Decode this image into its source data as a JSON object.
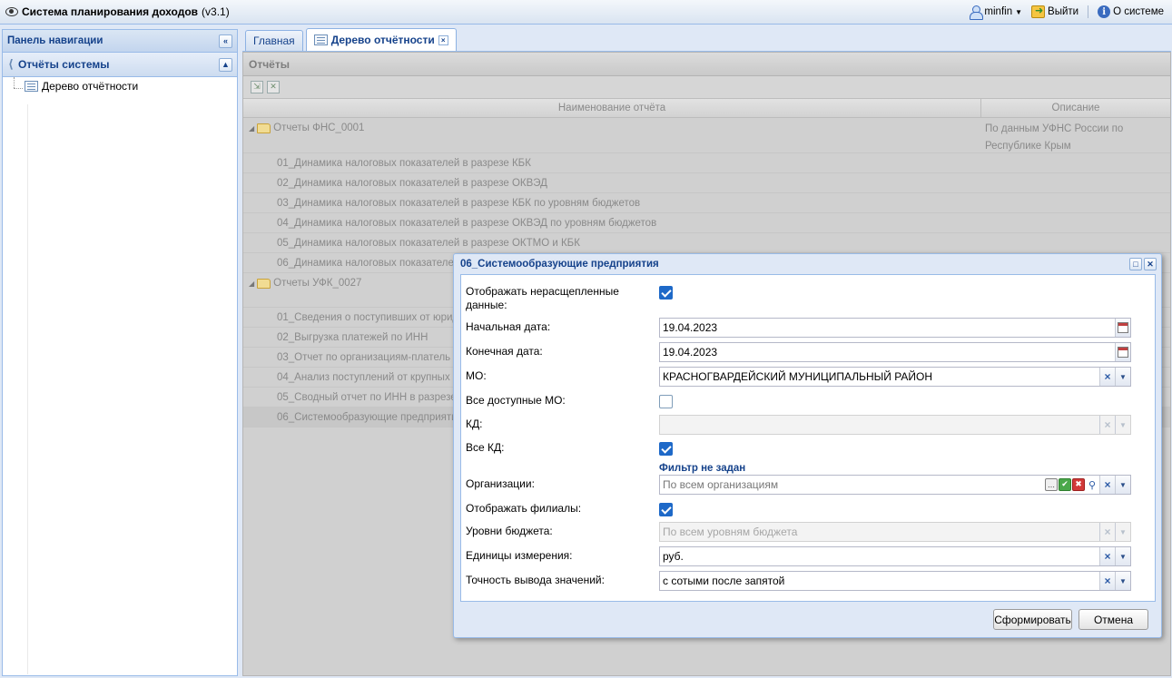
{
  "app": {
    "title": "Система планирования доходов",
    "version": "(v3.1)",
    "user_label": "minfin",
    "logout_label": "Выйти",
    "about_label": "О системе"
  },
  "nav": {
    "header": "Панель навигации",
    "section_title": "Отчёты системы",
    "items": [
      {
        "label": "Дерево отчётности"
      }
    ]
  },
  "tabs": [
    {
      "label": "Главная"
    },
    {
      "label": "Дерево отчётности"
    }
  ],
  "reports_panel": {
    "title": "Отчёты",
    "columns": {
      "name": "Наименование отчёта",
      "description": "Описание"
    },
    "groups": [
      {
        "name": "Отчеты ФНС_0001",
        "description": "По данным УФНС России по Республике Крым",
        "items": [
          "01_Динамика налоговых показателей в разрезе КБК",
          "02_Динамика налоговых показателей в разрезе ОКВЭД",
          "03_Динамика налоговых показателей в разрезе КБК по уровням бюджетов",
          "04_Динамика налоговых показателей в разрезе ОКВЭД по уровням бюджетов",
          "05_Динамика налоговых показателей в разрезе ОКТМО и КБК",
          "06_Динамика налоговых показателей"
        ]
      },
      {
        "name": "Отчеты УФК_0027",
        "description": "",
        "items": [
          "01_Сведения о поступивших от юрид",
          "02_Выгрузка платежей по ИНН",
          "03_Отчет по организациям-платель",
          "04_Анализ поступлений от крупных",
          "05_Сводный отчет по ИНН в разрезе",
          "06_Системообразующие предприяти"
        ]
      }
    ]
  },
  "dialog": {
    "title": "06_Системообразующие предприятия",
    "fields": {
      "show_unsplit": {
        "label": "Отображать нерасщепленные данные:",
        "checked": true
      },
      "start_date": {
        "label": "Начальная дата:",
        "value": "19.04.2023"
      },
      "end_date": {
        "label": "Конечная дата:",
        "value": "19.04.2023"
      },
      "mo": {
        "label": "МО:",
        "value": "КРАСНОГВАРДЕЙСКИЙ МУНИЦИПАЛЬНЫЙ РАЙОН"
      },
      "all_mo": {
        "label": "Все доступные МО:",
        "checked": false
      },
      "kd": {
        "label": "КД:",
        "value": ""
      },
      "all_kd": {
        "label": "Все КД:",
        "checked": true
      },
      "filter_note": "Фильтр не задан",
      "organizations": {
        "label": "Организации:",
        "placeholder": "По всем организациям"
      },
      "show_branches": {
        "label": "Отображать филиалы:",
        "checked": true
      },
      "budget_levels": {
        "label": "Уровни бюджета:",
        "placeholder": "По всем уровням бюджета"
      },
      "units": {
        "label": "Единицы измерения:",
        "value": "руб."
      },
      "precision": {
        "label": "Точность вывода значений:",
        "value": "с сотыми после запятой"
      }
    },
    "buttons": {
      "submit": "Сформировать",
      "cancel": "Отмена"
    }
  },
  "colors": {
    "accent": "#15428b",
    "border": "#99bbe8",
    "checkbox": "#1e69c8"
  }
}
